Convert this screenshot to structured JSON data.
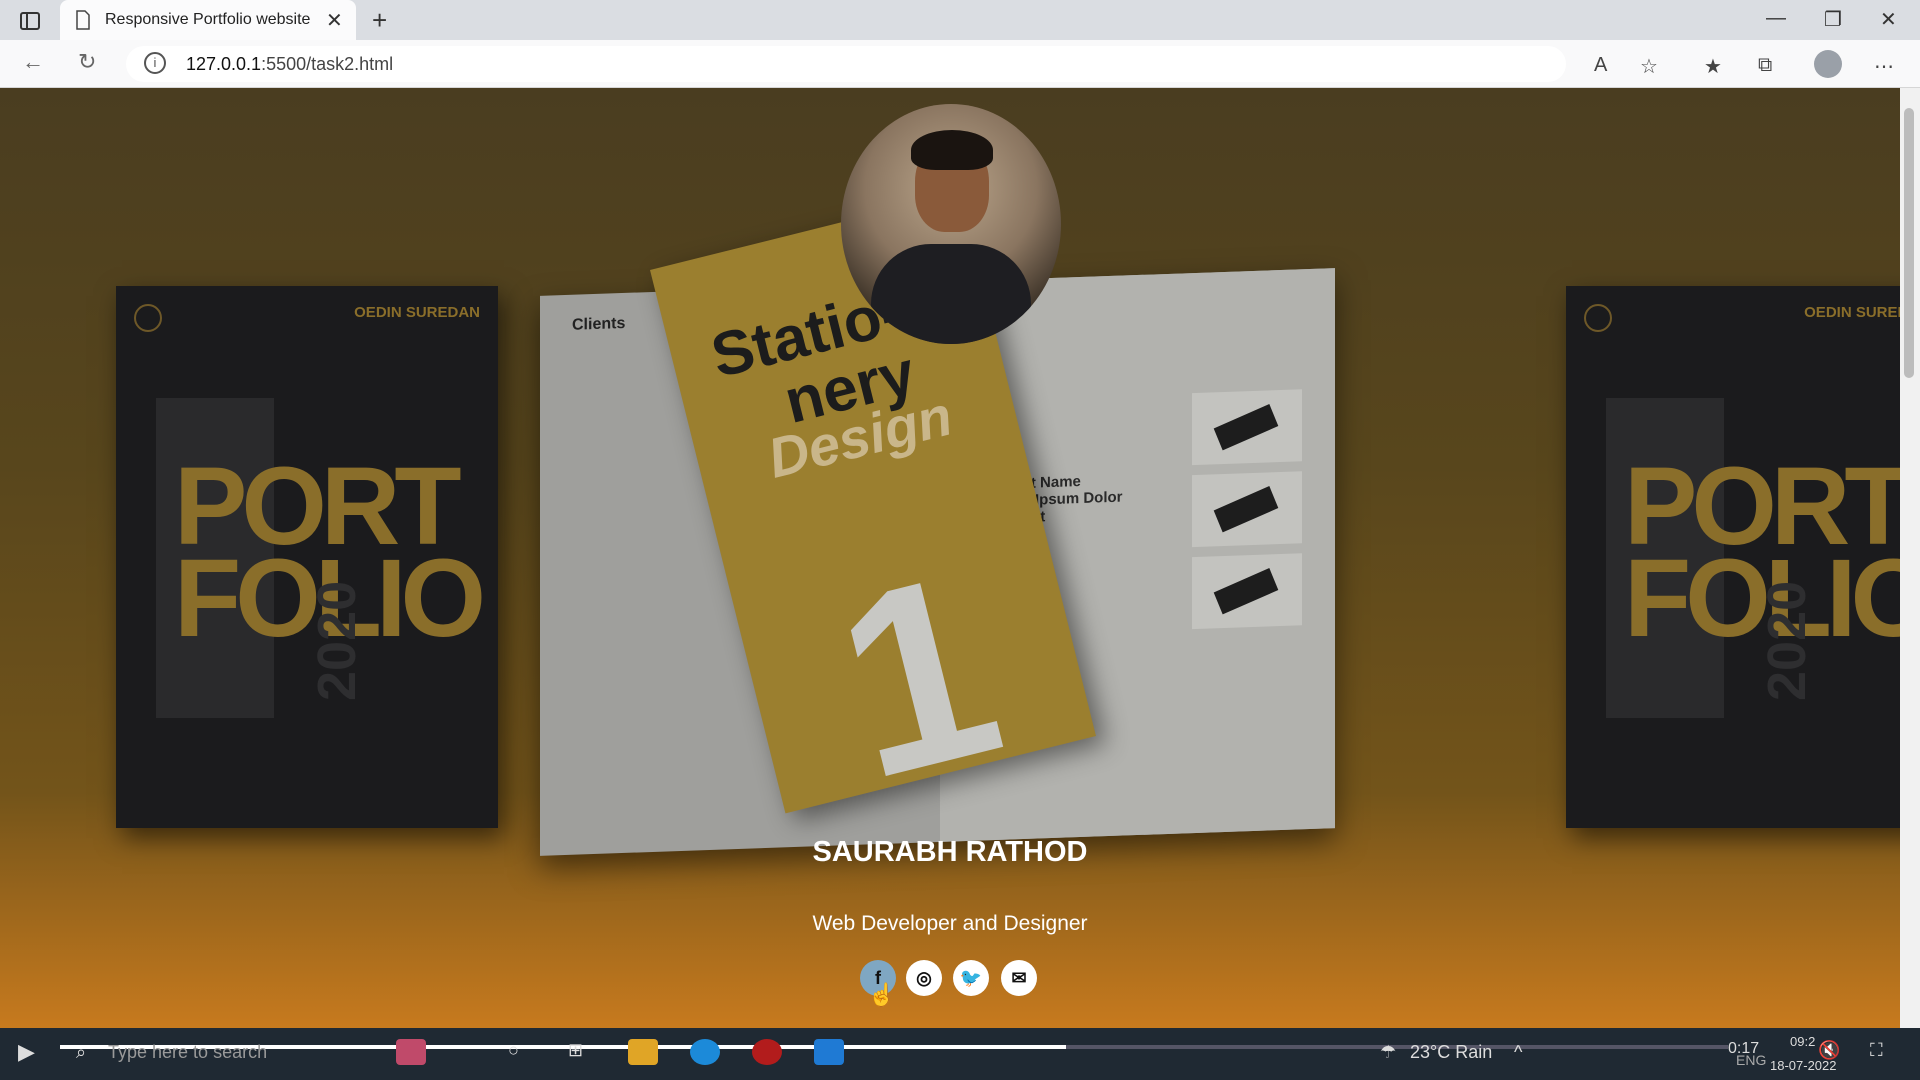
{
  "browser": {
    "tab_title": "Responsive Portfolio website",
    "url_host": "127.0.0.1",
    "url_path": ":5500/task2.html"
  },
  "page": {
    "name": "SAURABH RATHOD",
    "role": "Web Developer and Designer",
    "social_links": [
      "facebook",
      "instagram",
      "twitter",
      "email"
    ],
    "active_social": "facebook"
  },
  "background": {
    "book_brand": "OEDIN SUREDAN",
    "book_title_line1": "PORT",
    "book_title_line2": "FOLIO",
    "book_year": "2020",
    "mag_clients": "Clients",
    "fold_line1": "Statio-",
    "fold_line2": "nery",
    "fold_line3": "Design",
    "fold_number": "1",
    "project_name": "Project Name",
    "project_lorem1": "Lorem Ipsum Dolor",
    "project_lorem2": "Sit Amet"
  },
  "video": {
    "time": "0:17",
    "progress": 0.6
  },
  "taskbar": {
    "search_placeholder": "Type here to search",
    "weather": "23°C  Rain",
    "language": "ENG",
    "clock": "09:2",
    "date": "18-07-2022"
  },
  "colors": {
    "accent": "#c77a1e",
    "active_social": "#7fa7c2"
  }
}
